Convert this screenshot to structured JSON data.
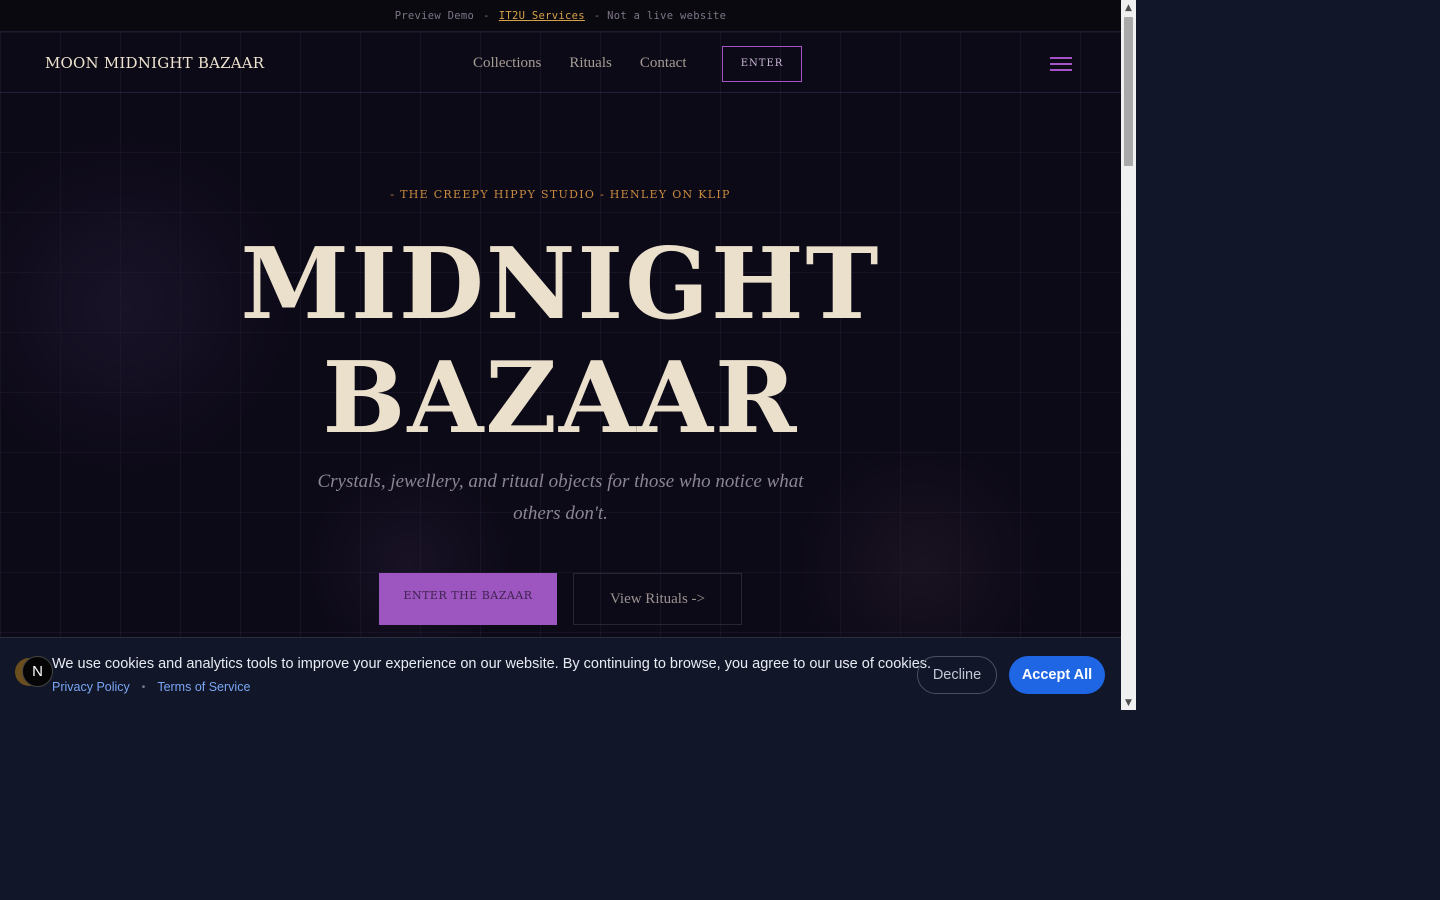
{
  "preview_bar": {
    "left_text": "Preview Demo",
    "separator": "-",
    "link_text": "IT2U Services",
    "right_text": "- Not a live website"
  },
  "nav": {
    "logo": "MOON MIDNIGHT BAZAAR",
    "links": [
      "Collections",
      "Rituals",
      "Contact"
    ],
    "enter_label": "ENTER",
    "menu_icon": "hamburger-menu-icon"
  },
  "hero": {
    "eyebrow": "- THE CREEPY HIPPY STUDIO - HENLEY ON KLIP",
    "title_line1": "MIDNIGHT",
    "title_line2": "BAZAAR",
    "subtitle": "Crystals, jewellery, and ritual objects for those who notice what others don't.",
    "primary_cta": "ENTER THE BAZAAR",
    "secondary_cta": "View Rituals ->"
  },
  "cookie_banner": {
    "badge_letter": "N",
    "message": "We use cookies and analytics tools to improve your experience on our website. By continuing to browse, you agree to our use of cookies.",
    "privacy_link": "Privacy Policy",
    "dot": "•",
    "terms_link": "Terms of Service",
    "decline_label": "Decline",
    "accept_label": "Accept All"
  },
  "scrollbar": {
    "up_glyph": "▲",
    "down_glyph": "▼"
  },
  "colors": {
    "accent_purple": "#9d55c0",
    "gold": "#c98a3e",
    "cream": "#ebe0cb",
    "background": "#0d0a18",
    "accept_blue": "#1f66e5"
  }
}
